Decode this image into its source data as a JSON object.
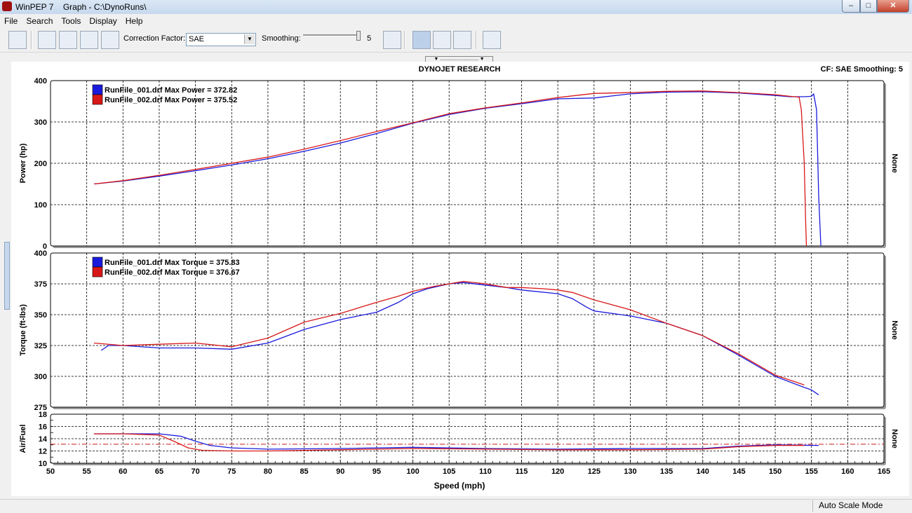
{
  "window": {
    "app": "WinPEP 7",
    "title": "Graph - C:\\DynoRuns\\",
    "controls": {
      "minimize": "–",
      "maximize": "□",
      "close": "✕"
    }
  },
  "menu": [
    "File",
    "Search",
    "Tools",
    "Display",
    "Help"
  ],
  "toolbar": {
    "correction_label": "Correction Factor:",
    "correction_value": "SAE",
    "smoothing_label": "Smoothing:",
    "smoothing_value": "5"
  },
  "header": {
    "center": "DYNOJET RESEARCH",
    "right": "CF: SAE  Smoothing: 5"
  },
  "status": "Auto Scale Mode",
  "colors": {
    "run1": "#1a1adc",
    "run2": "#d81818",
    "grid": "#000000",
    "afr_ref": "#c81818"
  },
  "chart_data": {
    "type": "line",
    "xlabel": "Speed (mph)",
    "xlim": [
      50,
      165
    ],
    "xticks": [
      "50",
      "55",
      "60",
      "65",
      "70",
      "75",
      "80",
      "85",
      "90",
      "95",
      "100",
      "105",
      "110",
      "115",
      "120",
      "125",
      "130",
      "135",
      "140",
      "145",
      "150",
      "155",
      "160",
      "165"
    ],
    "panels": [
      {
        "name": "power",
        "ylabel": "Power (hp)",
        "right_label": "None",
        "ylim": [
          0,
          400
        ],
        "yticks": [
          "0",
          "100",
          "200",
          "300",
          "400"
        ],
        "series": [
          {
            "name": "RunFile_001.drf",
            "legend": "RunFile_001.drf Max Power = 372.82",
            "x": [
              56,
              60,
              65,
              70,
              75,
              80,
              85,
              90,
              95,
              100,
              105,
              110,
              115,
              120,
              125,
              130,
              135,
              140,
              145,
              150,
              152,
              154,
              155,
              155.3,
              155.7,
              156,
              156.3
            ],
            "y": [
              150,
              157,
              169,
              182,
              196,
              211,
              229,
              249,
              272,
              297,
              318,
              333,
              344,
              356,
              358,
              368,
              372,
              373,
              370,
              364,
              361,
              361,
              362,
              368,
              330,
              120,
              0
            ]
          },
          {
            "name": "RunFile_002.drf",
            "legend": "RunFile_002.drf Max Power = 375.52",
            "x": [
              56,
              60,
              65,
              70,
              75,
              80,
              85,
              90,
              95,
              100,
              105,
              110,
              115,
              120,
              125,
              130,
              135,
              140,
              145,
              150,
              152,
              153.3,
              153.6,
              154,
              154.2,
              154.3
            ],
            "y": [
              150,
              158,
              171,
              185,
              200,
              215,
              234,
              255,
              277,
              298,
              320,
              334,
              346,
              359,
              369,
              371,
              374,
              375,
              371,
              366,
              362,
              360,
              330,
              200,
              60,
              0
            ]
          }
        ]
      },
      {
        "name": "torque",
        "ylabel": "Torque (ft-lbs)",
        "right_label": "None",
        "ylim": [
          275,
          400
        ],
        "yticks": [
          "275",
          "300",
          "325",
          "350",
          "375",
          "400"
        ],
        "series": [
          {
            "name": "RunFile_001.drf",
            "legend": "RunFile_001.drf Max Torque = 375.83",
            "x": [
              57,
              58,
              60,
              65,
              70,
              75,
              80,
              85,
              90,
              95,
              98,
              100,
              102,
              105,
              107,
              110,
              113,
              115,
              120,
              122,
              124,
              125,
              130,
              135,
              140,
              145,
              150,
              154,
              155,
              156
            ],
            "y": [
              321,
              325,
              325,
              323,
              323,
              322,
              327,
              338,
              346,
              352,
              360,
              367,
              371,
              375,
              376,
              374,
              372,
              370,
              367,
              363,
              356,
              353,
              349,
              343,
              333,
              317,
              300,
              291,
              289,
              285
            ]
          },
          {
            "name": "RunFile_002.drf",
            "legend": "RunFile_002.drf Max Torque = 376.67",
            "x": [
              56,
              60,
              65,
              70,
              75,
              80,
              85,
              90,
              95,
              98,
              100,
              103,
              105,
              107,
              110,
              113,
              115,
              118,
              120,
              122,
              125,
              130,
              135,
              140,
              145,
              150,
              154
            ],
            "y": [
              327,
              325,
              326,
              327,
              324,
              331,
              344,
              351,
              360,
              365,
              369,
              373,
              375,
              377,
              375,
              372,
              372,
              371,
              370,
              368,
              362,
              354,
              343,
              333,
              318,
              301,
              293
            ]
          }
        ]
      },
      {
        "name": "afr",
        "ylabel": "Air/Fuel",
        "right_label": "None",
        "ylim": [
          10,
          18
        ],
        "yticks": [
          "10",
          "12",
          "14",
          "16",
          "18"
        ],
        "reference_line": 13.1,
        "series": [
          {
            "name": "RunFile_001.drf",
            "x": [
              56,
              60,
              65,
              68,
              70,
              72,
              75,
              80,
              90,
              100,
              110,
              120,
              130,
              140,
              145,
              150,
              156
            ],
            "y": [
              14.8,
              14.8,
              14.8,
              14.4,
              13.6,
              12.9,
              12.5,
              12.3,
              12.4,
              12.6,
              12.4,
              12.3,
              12.4,
              12.4,
              12.8,
              13.0,
              12.9
            ]
          },
          {
            "name": "RunFile_002.drf",
            "x": [
              56,
              60,
              65,
              67,
              69,
              71,
              75,
              80,
              90,
              100,
              110,
              120,
              130,
              140,
              145,
              150,
              154
            ],
            "y": [
              14.8,
              14.8,
              14.6,
              13.6,
              12.5,
              12.1,
              12.0,
              12.0,
              12.2,
              12.4,
              12.3,
              12.2,
              12.2,
              12.3,
              12.7,
              12.9,
              12.9
            ]
          }
        ]
      }
    ]
  }
}
